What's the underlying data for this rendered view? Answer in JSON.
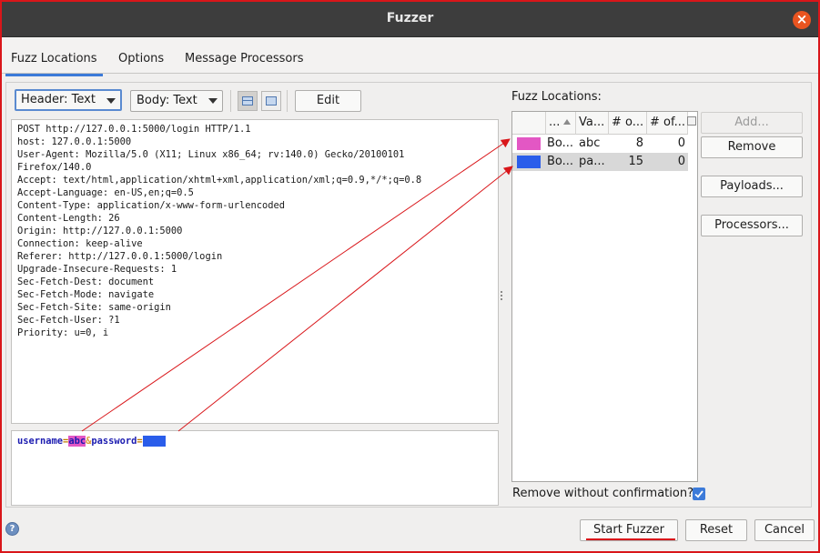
{
  "window": {
    "title": "Fuzzer"
  },
  "tabs": [
    {
      "label": "Fuzz Locations",
      "active": true
    },
    {
      "label": "Options",
      "active": false
    },
    {
      "label": "Message Processors",
      "active": false
    }
  ],
  "toolbar": {
    "header_view": "Header: Text",
    "body_view": "Body: Text",
    "edit_label": "Edit"
  },
  "request": {
    "header_lines": [
      "POST http://127.0.0.1:5000/login HTTP/1.1",
      "host: 127.0.0.1:5000",
      "User-Agent: Mozilla/5.0 (X11; Linux x86_64; rv:140.0) Gecko/20100101",
      "Firefox/140.0",
      "Accept: text/html,application/xhtml+xml,application/xml;q=0.9,*/*;q=0.8",
      "Accept-Language: en-US,en;q=0.5",
      "Content-Type: application/x-www-form-urlencoded",
      "Content-Length: 26",
      "Origin: http://127.0.0.1:5000",
      "Connection: keep-alive",
      "Referer: http://127.0.0.1:5000/login",
      "Upgrade-Insecure-Requests: 1",
      "Sec-Fetch-Dest: document",
      "Sec-Fetch-Mode: navigate",
      "Sec-Fetch-Site: same-origin",
      "Sec-Fetch-User: ?1",
      "Priority: u=0, i"
    ],
    "body": {
      "param1_name": "username",
      "eq": "=",
      "param1_value": "abc",
      "amp": "&",
      "param2_name": "password",
      "param2_value": "pass"
    }
  },
  "fuzz_locations": {
    "label": "Fuzz Locations:",
    "columns": [
      "...",
      "Va...",
      "# o...",
      "# of..."
    ],
    "rows": [
      {
        "color": "#e357c4",
        "location": "Bo...",
        "value": "abc",
        "count1": "8",
        "count2": "0"
      },
      {
        "color": "#2a5dea",
        "location": "Bo...",
        "value": "pa...",
        "count1": "15",
        "count2": "0"
      }
    ]
  },
  "side_buttons": {
    "add": "Add...",
    "remove": "Remove",
    "payloads": "Payloads...",
    "processors": "Processors..."
  },
  "remove_confirm_label": "Remove without confirmation?",
  "remove_confirm_checked": true,
  "footer": {
    "start": "Start Fuzzer",
    "reset": "Reset",
    "cancel": "Cancel"
  },
  "colors": {
    "accent": "#3b7ad8",
    "annotation_red": "#d9161a",
    "pink_location": "#e357c4",
    "blue_location": "#2a5dea"
  }
}
